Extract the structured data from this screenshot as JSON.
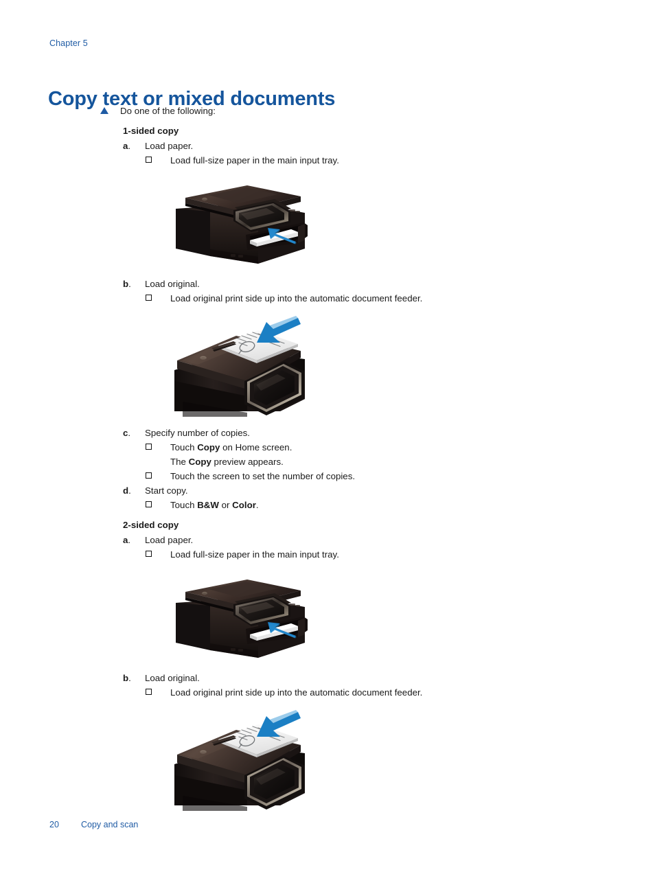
{
  "header": {
    "chapter": "Chapter 5"
  },
  "title": "Copy text or mixed documents",
  "intro": "Do one of the following:",
  "sections": [
    {
      "heading": "1-sided copy",
      "steps": [
        {
          "marker": "a",
          "text": "Load paper.",
          "bullets": [
            {
              "text": "Load full-size paper in the main input tray."
            }
          ],
          "figure": "printer-input-tray"
        },
        {
          "marker": "b",
          "text": "Load original.",
          "bullets": [
            {
              "text": "Load original print side up into the automatic document feeder."
            }
          ],
          "figure": "printer-document-feeder"
        },
        {
          "marker": "c",
          "text": "Specify number of copies.",
          "bullets": [
            {
              "text_before": "Touch ",
              "bold": "Copy",
              "text_after": " on Home screen."
            },
            {
              "continuation_before": "The ",
              "continuation_bold": "Copy",
              "continuation_after": " preview appears."
            },
            {
              "text": "Touch the screen to set the number of copies."
            }
          ]
        },
        {
          "marker": "d",
          "text": "Start copy.",
          "bullets": [
            {
              "text_before": "Touch ",
              "bold": "B&W",
              "text_mid": " or ",
              "bold2": "Color",
              "text_after": "."
            }
          ]
        }
      ]
    },
    {
      "heading": "2-sided copy",
      "steps": [
        {
          "marker": "a",
          "text": "Load paper.",
          "bullets": [
            {
              "text": "Load full-size paper in the main input tray."
            }
          ],
          "figure": "printer-input-tray"
        },
        {
          "marker": "b",
          "text": "Load original.",
          "bullets": [
            {
              "text": "Load original print side up into the automatic document feeder."
            }
          ],
          "figure": "printer-document-feeder"
        }
      ]
    }
  ],
  "figures": {
    "printer_input_tray_alt": "HP all-in-one printer with paper being loaded into the main input tray, blue arrow pointing into the tray",
    "printer_document_feeder_alt": "Top of HP all-in-one printer with original document loaded print side up in the automatic document feeder, blue arrow pointing down"
  },
  "footer": {
    "page_number": "20",
    "section_label": "Copy and scan"
  },
  "colors": {
    "heading_blue": "#15559c",
    "link_blue": "#1f5ba4",
    "arrow_blue": "#1b7fc4",
    "body_text": "#1a1a1a"
  }
}
